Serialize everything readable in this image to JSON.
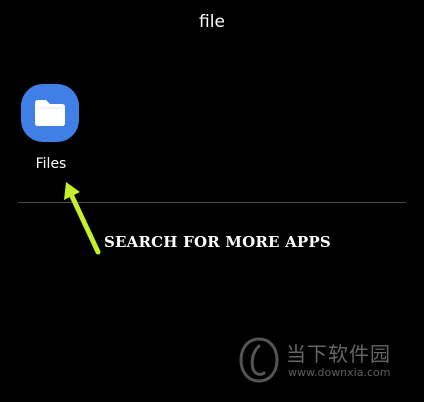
{
  "search": {
    "query": "file"
  },
  "results": [
    {
      "label": "Files",
      "icon": "folder-icon",
      "icon_bg": "#3f7fe6"
    }
  ],
  "annotation": {
    "text": "SEARCH FOR MORE APPS",
    "arrow_color": "#c6f12a"
  },
  "watermark": {
    "title": "当下软件园",
    "url": "www.downxia.com"
  }
}
